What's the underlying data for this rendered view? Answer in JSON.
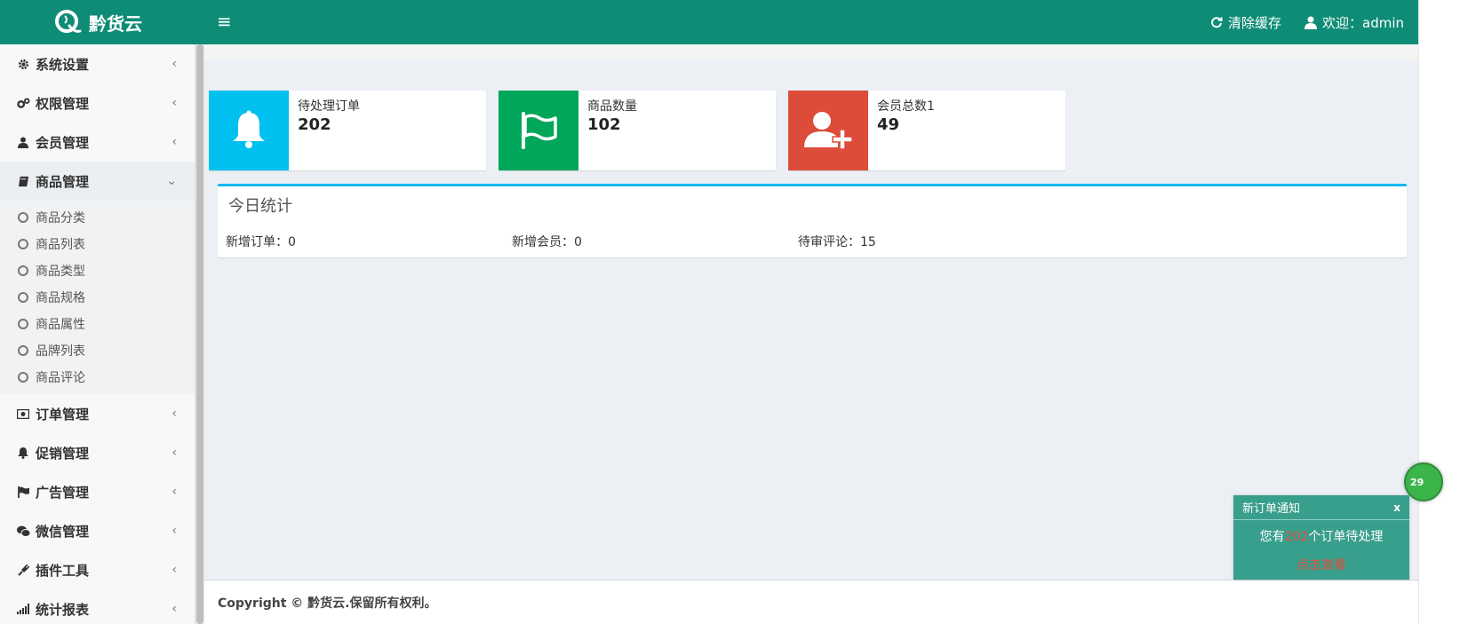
{
  "header": {
    "logo_text": "黔货云",
    "clear_cache_label": "清除缓存",
    "welcome_label": "欢迎：admin"
  },
  "sidebar": {
    "items": [
      {
        "label": "系统设置",
        "icon": "gear-icon"
      },
      {
        "label": "权限管理",
        "icon": "cogs-icon"
      },
      {
        "label": "会员管理",
        "icon": "user-icon"
      },
      {
        "label": "商品管理",
        "icon": "book-icon"
      },
      {
        "label": "订单管理",
        "icon": "money-icon"
      },
      {
        "label": "促销管理",
        "icon": "bell-icon"
      },
      {
        "label": "广告管理",
        "icon": "flag-icon"
      },
      {
        "label": "微信管理",
        "icon": "wechat-icon"
      },
      {
        "label": "插件工具",
        "icon": "plug-icon"
      },
      {
        "label": "统计报表",
        "icon": "signal-icon"
      }
    ],
    "sub_items": [
      "商品分类",
      "商品列表",
      "商品类型",
      "商品规格",
      "商品属性",
      "品牌列表",
      "商品评论"
    ]
  },
  "info_boxes": [
    {
      "label": "待处理订单",
      "value": "202",
      "color": "#00c0ef",
      "icon": "bell-icon"
    },
    {
      "label": "商品数量",
      "value": "102",
      "color": "#00a65a",
      "icon": "flag-icon"
    },
    {
      "label": "会员总数1",
      "value": "49",
      "color": "#dd4b39",
      "icon": "user-plus-icon"
    }
  ],
  "today_stats": {
    "title": "今日统计",
    "new_orders": "新增订单：0",
    "new_members": "新增会员：0",
    "pending_reviews": "待审评论：15"
  },
  "footer": {
    "copyright": "Copyright © 黔货云.保留所有权利。"
  },
  "notification": {
    "title": "新订单通知",
    "close": "x",
    "prefix": "您有",
    "count": "202",
    "suffix": "个订单待处理",
    "link": "点击查看"
  },
  "float_badge": "29"
}
